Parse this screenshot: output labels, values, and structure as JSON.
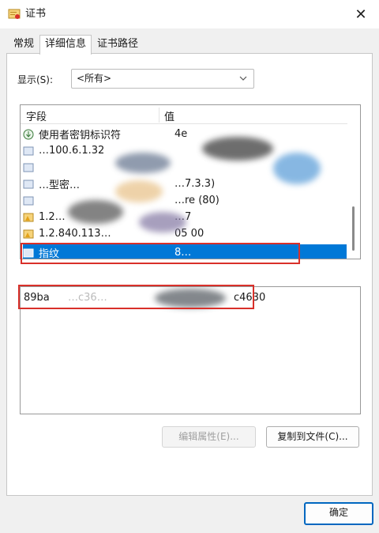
{
  "window": {
    "title": "证书",
    "close_glyph": "✕"
  },
  "tabs": [
    {
      "label": "常规",
      "active": false
    },
    {
      "label": "详细信息",
      "active": true
    },
    {
      "label": "证书路径",
      "active": false
    }
  ],
  "show": {
    "label": "显示(S):",
    "selected": "<所有>"
  },
  "list": {
    "col_field": "字段",
    "col_value": "值",
    "rows": [
      {
        "field": "使用者密钥标识符",
        "value": "4e",
        "icon": "key-icon"
      },
      {
        "field": "…100.6.1.32",
        "value": "",
        "icon": "cert-icon"
      },
      {
        "field": "",
        "value": "",
        "icon": "cert-icon"
      },
      {
        "field": "…型密…",
        "value": "…7.3.3)",
        "icon": "cert-icon"
      },
      {
        "field": "",
        "value": "…re (80)",
        "icon": "cert-icon"
      },
      {
        "field": "1.2…",
        "value": "…7",
        "icon": "cert-warning-icon"
      },
      {
        "field": "1.2.840.113…",
        "value": "05 00",
        "icon": "cert-warning-icon"
      },
      {
        "field": "指纹",
        "value": "8…",
        "icon": "cert-icon",
        "selected": true
      }
    ]
  },
  "value_panel": {
    "text_start": "89ba",
    "text_mid": "…c36…",
    "text_end": "c4630"
  },
  "buttons": {
    "edit_properties": "编辑属性(E)...",
    "copy_to_file": "复制到文件(C)...",
    "ok": "确定"
  },
  "colors": {
    "selection": "#0078d7",
    "highlight_box": "#d9302a",
    "primary_border": "#0067c0"
  }
}
